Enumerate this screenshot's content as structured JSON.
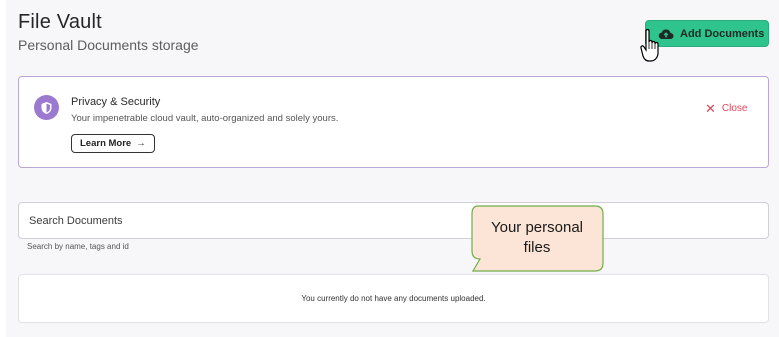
{
  "header": {
    "title": "File Vault",
    "subtitle": "Personal Documents storage",
    "add_button_label": "Add Documents"
  },
  "privacy_banner": {
    "title": "Privacy & Security",
    "description": "Your impenetrable cloud vault, auto-organized and solely yours.",
    "learn_more_label": "Learn More",
    "learn_more_arrow": "→",
    "close_label": "Close",
    "close_glyph": "✕"
  },
  "search": {
    "placeholder": "Search Documents",
    "hint": "Search by name, tags and id"
  },
  "documents": {
    "empty_message": "You currently do not have any documents uploaded."
  },
  "callout": {
    "line1": "Your personal",
    "line2": "files"
  },
  "colors": {
    "accent_green": "#2fc38d",
    "banner_border": "#b9a7d8",
    "shield_purple": "#9b79d1",
    "close_red": "#e0455a",
    "callout_fill": "#fce4d6",
    "callout_border": "#70ad47"
  },
  "icons": {
    "add": "cloud-upload-icon",
    "banner": "shield-icon",
    "cursor": "hand-pointer-icon"
  }
}
